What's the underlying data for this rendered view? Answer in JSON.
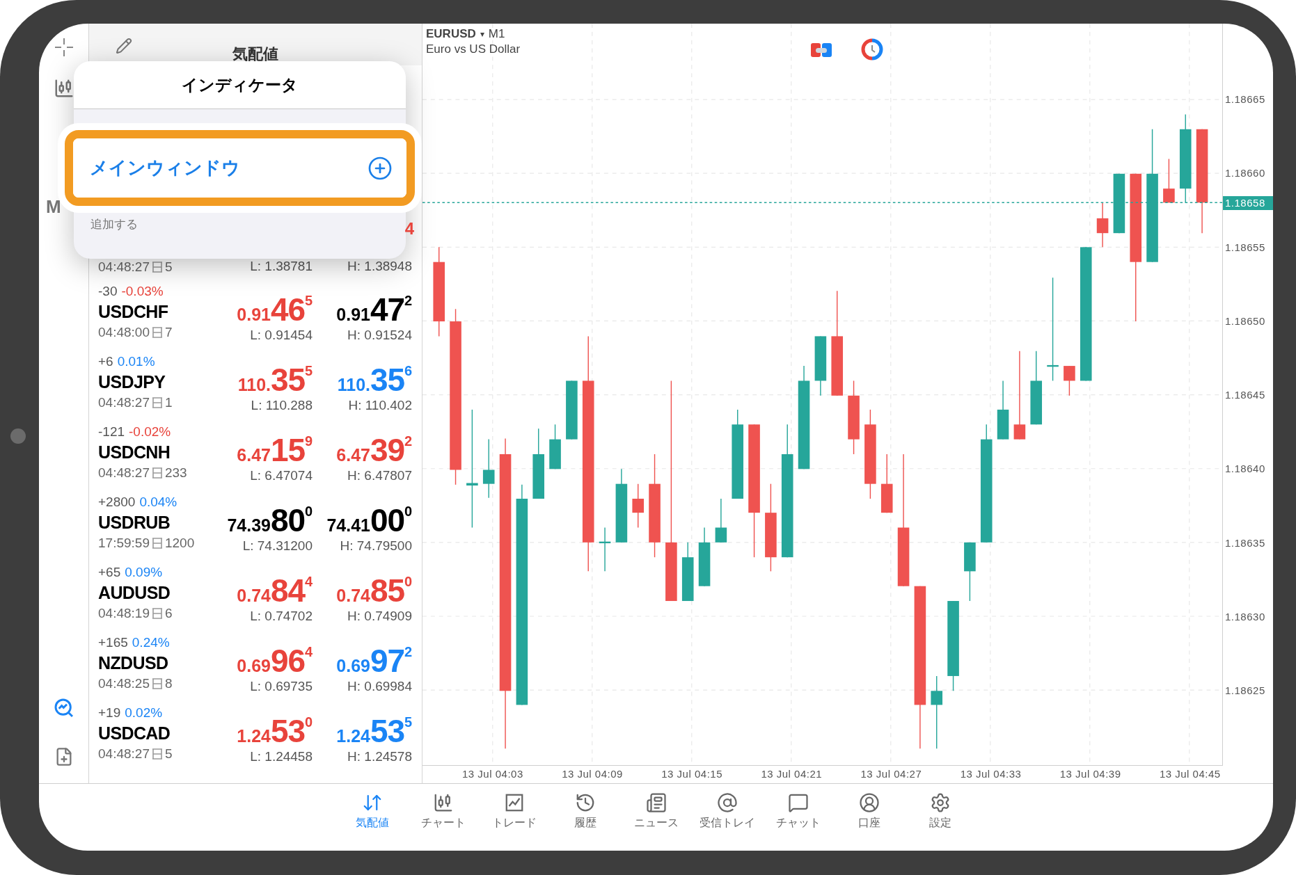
{
  "toolbar": {
    "timeframe_label": "M"
  },
  "quotes": {
    "title": "気配値",
    "covered_row": {
      "time": "04:48:27",
      "ticks": "5",
      "low": "L: 1.38781",
      "high": "H: 1.38948",
      "ask_tail": {
        "text": "4",
        "color": "#e8433b"
      }
    },
    "rows": [
      {
        "change": "-30",
        "change_pct": {
          "text": "-0.03%",
          "color": "#e8433b"
        },
        "symbol": "USDCHF",
        "time": "04:48:00",
        "ticks": "7",
        "bid": {
          "prefix": "0.91",
          "big": "46",
          "sup": "5",
          "color": "#e8433b"
        },
        "ask": {
          "prefix": "0.91",
          "big": "47",
          "sup": "2",
          "color": "#000000"
        },
        "low": "L: 0.91454",
        "high": "H: 0.91524"
      },
      {
        "change": "+6",
        "change_pct": {
          "text": "0.01%",
          "color": "#1a84f5"
        },
        "symbol": "USDJPY",
        "time": "04:48:27",
        "ticks": "1",
        "bid": {
          "prefix": "110.",
          "big": "35",
          "sup": "5",
          "color": "#e8433b"
        },
        "ask": {
          "prefix": "110.",
          "big": "35",
          "sup": "6",
          "color": "#1a84f5"
        },
        "low": "L: 110.288",
        "high": "H: 110.402"
      },
      {
        "change": "-121",
        "change_pct": {
          "text": "-0.02%",
          "color": "#e8433b"
        },
        "symbol": "USDCNH",
        "time": "04:48:27",
        "ticks": "233",
        "bid": {
          "prefix": "6.47",
          "big": "15",
          "sup": "9",
          "color": "#e8433b"
        },
        "ask": {
          "prefix": "6.47",
          "big": "39",
          "sup": "2",
          "color": "#e8433b"
        },
        "low": "L: 6.47074",
        "high": "H: 6.47807"
      },
      {
        "change": "+2800",
        "change_pct": {
          "text": "0.04%",
          "color": "#1a84f5"
        },
        "symbol": "USDRUB",
        "time": "17:59:59",
        "ticks": "1200",
        "bid": {
          "prefix": "74.39",
          "big": "80",
          "sup": "0",
          "color": "#000000"
        },
        "ask": {
          "prefix": "74.41",
          "big": "00",
          "sup": "0",
          "color": "#000000"
        },
        "low": "L: 74.31200",
        "high": "H: 74.79500"
      },
      {
        "change": "+65",
        "change_pct": {
          "text": "0.09%",
          "color": "#1a84f5"
        },
        "symbol": "AUDUSD",
        "time": "04:48:19",
        "ticks": "6",
        "bid": {
          "prefix": "0.74",
          "big": "84",
          "sup": "4",
          "color": "#e8433b"
        },
        "ask": {
          "prefix": "0.74",
          "big": "85",
          "sup": "0",
          "color": "#e8433b"
        },
        "low": "L: 0.74702",
        "high": "H: 0.74909"
      },
      {
        "change": "+165",
        "change_pct": {
          "text": "0.24%",
          "color": "#1a84f5"
        },
        "symbol": "NZDUSD",
        "time": "04:48:25",
        "ticks": "8",
        "bid": {
          "prefix": "0.69",
          "big": "96",
          "sup": "4",
          "color": "#e8433b"
        },
        "ask": {
          "prefix": "0.69",
          "big": "97",
          "sup": "2",
          "color": "#1a84f5"
        },
        "low": "L: 0.69735",
        "high": "H: 0.69984"
      },
      {
        "change": "+19",
        "change_pct": {
          "text": "0.02%",
          "color": "#1a84f5"
        },
        "symbol": "USDCAD",
        "time": "04:48:27",
        "ticks": "5",
        "bid": {
          "prefix": "1.24",
          "big": "53",
          "sup": "0",
          "color": "#e8433b"
        },
        "ask": {
          "prefix": "1.24",
          "big": "53",
          "sup": "5",
          "color": "#1a84f5"
        },
        "low": "L: 1.24458",
        "high": "H: 1.24578"
      }
    ]
  },
  "popup": {
    "title": "インディケータ",
    "items": [
      {
        "label": "メインウィンドウ",
        "highlighted": true
      }
    ],
    "footer": "追加する"
  },
  "chart": {
    "symbol": "EURUSD",
    "caret": "▾",
    "timeframe": "M1",
    "description": "Euro vs US Dollar",
    "price_labels": [
      "1.18665",
      "1.18660",
      "1.18655",
      "1.18650",
      "1.18645",
      "1.18640",
      "1.18635",
      "1.18630",
      "1.18625"
    ],
    "current_price": "1.18658",
    "time_labels": [
      "13 Jul 04:03",
      "13 Jul 04:09",
      "13 Jul 04:15",
      "13 Jul 04:21",
      "13 Jul 04:27",
      "13 Jul 04:33",
      "13 Jul 04:39",
      "13 Jul 04:45"
    ]
  },
  "tabs": [
    {
      "kind": "quotes",
      "label": "気配値",
      "selected": true
    },
    {
      "kind": "chart",
      "label": "チャート",
      "selected": false
    },
    {
      "kind": "trade",
      "label": "トレード",
      "selected": false
    },
    {
      "kind": "history",
      "label": "履歴",
      "selected": false
    },
    {
      "kind": "news",
      "label": "ニュース",
      "selected": false
    },
    {
      "kind": "mail",
      "label": "受信トレイ",
      "selected": false
    },
    {
      "kind": "chat",
      "label": "チャット",
      "selected": false
    },
    {
      "kind": "account",
      "label": "口座",
      "selected": false
    },
    {
      "kind": "settings",
      "label": "設定",
      "selected": false
    }
  ]
}
